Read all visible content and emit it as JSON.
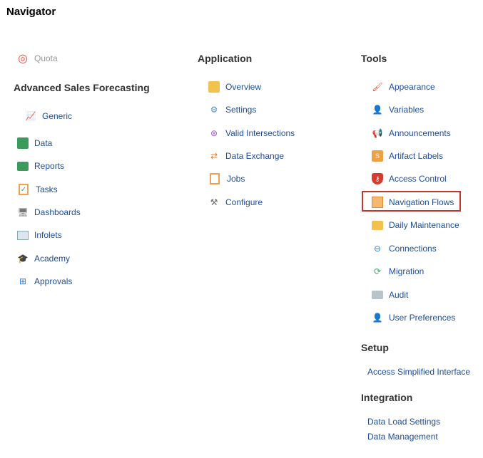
{
  "title": "Navigator",
  "quota": {
    "label": "Quota"
  },
  "col1": {
    "heading": "Advanced Sales Forecasting",
    "generic": "Generic",
    "items": [
      {
        "label": "Data"
      },
      {
        "label": "Reports"
      },
      {
        "label": "Tasks"
      },
      {
        "label": "Dashboards"
      },
      {
        "label": "Infolets"
      },
      {
        "label": "Academy"
      },
      {
        "label": "Approvals"
      }
    ]
  },
  "col2": {
    "heading": "Application",
    "items": [
      {
        "label": "Overview"
      },
      {
        "label": "Settings"
      },
      {
        "label": "Valid Intersections"
      },
      {
        "label": "Data Exchange"
      },
      {
        "label": "Jobs"
      },
      {
        "label": "Configure"
      }
    ]
  },
  "col3": {
    "heading": "Tools",
    "items": [
      {
        "label": "Appearance"
      },
      {
        "label": "Variables"
      },
      {
        "label": "Announcements"
      },
      {
        "label": "Artifact Labels"
      },
      {
        "label": "Access Control"
      },
      {
        "label": "Navigation Flows"
      },
      {
        "label": "Daily Maintenance"
      },
      {
        "label": "Connections"
      },
      {
        "label": "Migration"
      },
      {
        "label": "Audit"
      },
      {
        "label": "User Preferences"
      }
    ]
  },
  "setup": {
    "heading": "Setup",
    "links": [
      "Access Simplified Interface"
    ]
  },
  "integration": {
    "heading": "Integration",
    "links": [
      "Data Load Settings",
      "Data Management"
    ]
  }
}
